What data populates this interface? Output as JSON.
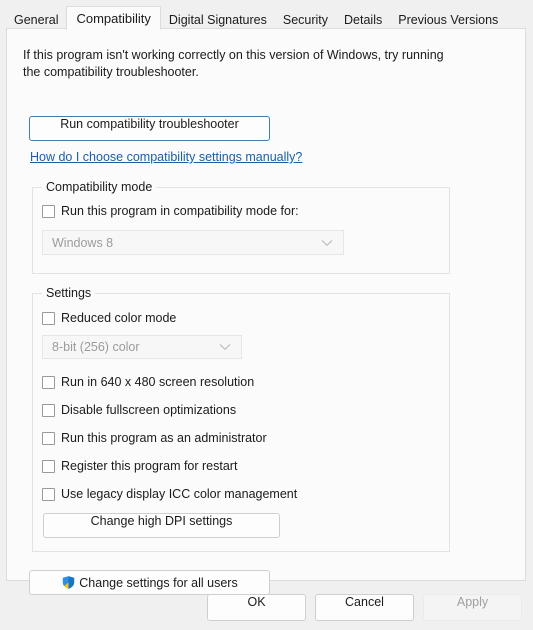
{
  "tabs": [
    {
      "label": "General",
      "selected": false
    },
    {
      "label": "Compatibility",
      "selected": true
    },
    {
      "label": "Digital Signatures",
      "selected": false
    },
    {
      "label": "Security",
      "selected": false
    },
    {
      "label": "Details",
      "selected": false
    },
    {
      "label": "Previous Versions",
      "selected": false
    }
  ],
  "intro": {
    "text": "If this program isn't working correctly on this version of Windows, try running the compatibility troubleshooter."
  },
  "troubleshooter": {
    "button_label": "Run compatibility troubleshooter",
    "link_label": "How do I choose compatibility settings manually?"
  },
  "compatibility_mode": {
    "legend": "Compatibility mode",
    "checkbox_label": "Run this program in compatibility mode for:",
    "checkbox_checked": false,
    "combo_value": "Windows 8",
    "combo_disabled": true
  },
  "settings": {
    "legend": "Settings",
    "reduced_color": {
      "label": "Reduced color mode",
      "checked": false
    },
    "color_depth_combo": {
      "value": "8-bit (256) color",
      "disabled": true
    },
    "checkboxes": [
      {
        "label": "Run in 640 x 480 screen resolution",
        "checked": false
      },
      {
        "label": "Disable fullscreen optimizations",
        "checked": false
      },
      {
        "label": "Run this program as an administrator",
        "checked": false
      },
      {
        "label": "Register this program for restart",
        "checked": false
      },
      {
        "label": "Use legacy display ICC color management",
        "checked": false
      }
    ],
    "dpi_button_label": "Change high DPI settings"
  },
  "all_users": {
    "button_label": "Change settings for all users",
    "icon": "uac-shield-icon"
  },
  "footer": {
    "ok_label": "OK",
    "cancel_label": "Cancel",
    "apply_label": "Apply",
    "apply_disabled": true
  },
  "colors": {
    "link": "#1a5fa8",
    "focus_border": "#4a7ba6",
    "panel_bg": "#fbfbfb",
    "dialog_bg": "#f0f0f0",
    "disabled_text": "#9b9b9b"
  }
}
